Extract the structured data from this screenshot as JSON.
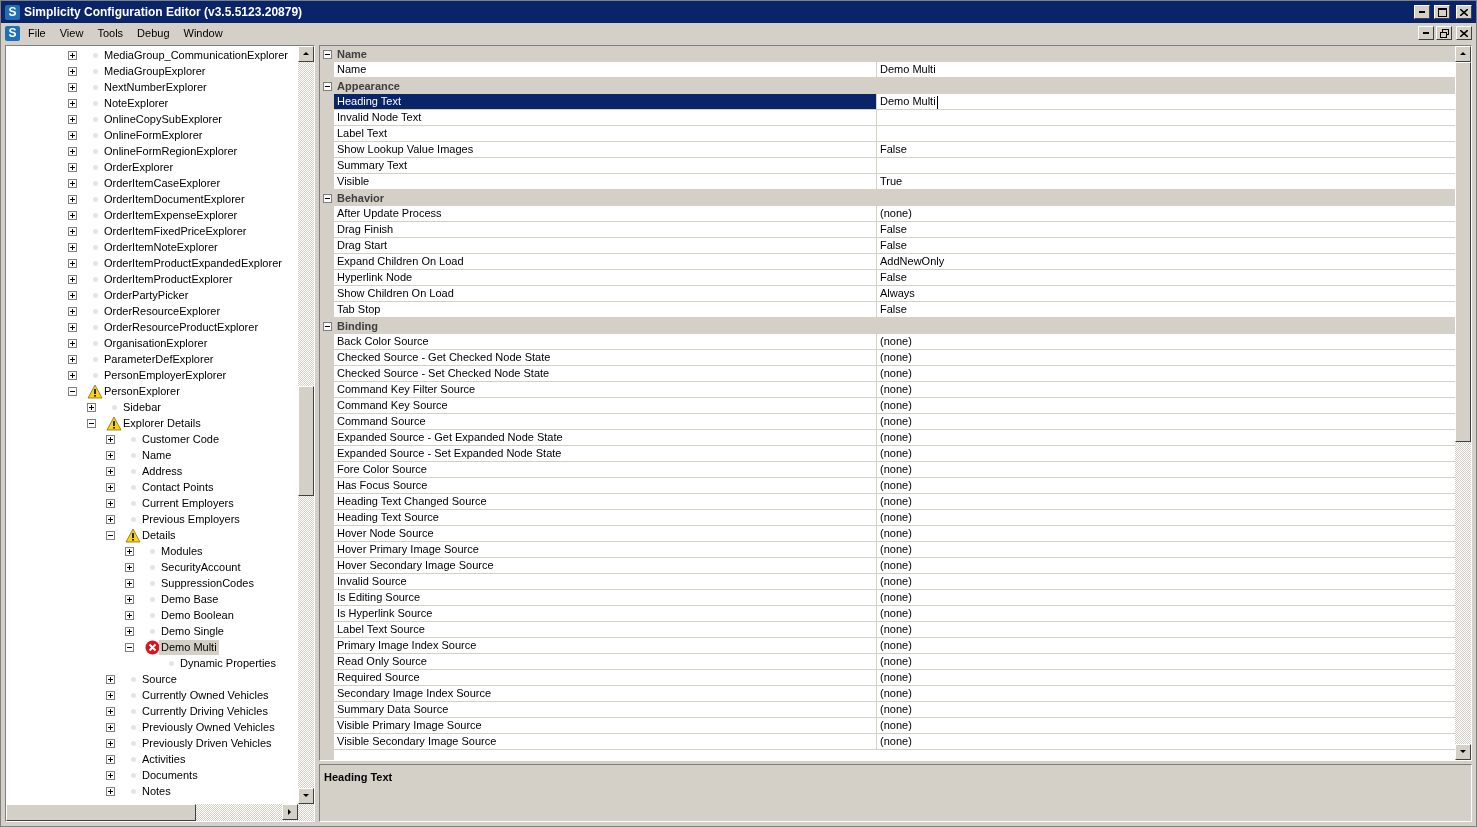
{
  "window": {
    "logo": "S",
    "title": "Simplicity Configuration Editor (v3.5.5123.20879)"
  },
  "menubar": {
    "logo": "S",
    "items": [
      "File",
      "View",
      "Tools",
      "Debug",
      "Window"
    ]
  },
  "tree": [
    {
      "label": "MediaGroup_CommunicationExplorer",
      "kind": "plain",
      "expanded": false,
      "selected": false
    },
    {
      "label": "MediaGroupExplorer",
      "kind": "plain",
      "expanded": false,
      "selected": false
    },
    {
      "label": "NextNumberExplorer",
      "kind": "plain",
      "expanded": false,
      "selected": false
    },
    {
      "label": "NoteExplorer",
      "kind": "plain",
      "expanded": false,
      "selected": false
    },
    {
      "label": "OnlineCopySubExplorer",
      "kind": "plain",
      "expanded": false,
      "selected": false
    },
    {
      "label": "OnlineFormExplorer",
      "kind": "plain",
      "expanded": false,
      "selected": false
    },
    {
      "label": "OnlineFormRegionExplorer",
      "kind": "plain",
      "expanded": false,
      "selected": false
    },
    {
      "label": "OrderExplorer",
      "kind": "plain",
      "expanded": false,
      "selected": false
    },
    {
      "label": "OrderItemCaseExplorer",
      "kind": "plain",
      "expanded": false,
      "selected": false
    },
    {
      "label": "OrderItemDocumentExplorer",
      "kind": "plain",
      "expanded": false,
      "selected": false
    },
    {
      "label": "OrderItemExpenseExplorer",
      "kind": "plain",
      "expanded": false,
      "selected": false
    },
    {
      "label": "OrderItemFixedPriceExplorer",
      "kind": "plain",
      "expanded": false,
      "selected": false
    },
    {
      "label": "OrderItemNoteExplorer",
      "kind": "plain",
      "expanded": false,
      "selected": false
    },
    {
      "label": "OrderItemProductExpandedExplorer",
      "kind": "plain",
      "expanded": false,
      "selected": false
    },
    {
      "label": "OrderItemProductExplorer",
      "kind": "plain",
      "expanded": false,
      "selected": false
    },
    {
      "label": "OrderPartyPicker",
      "kind": "plain",
      "expanded": false,
      "selected": false
    },
    {
      "label": "OrderResourceExplorer",
      "kind": "plain",
      "expanded": false,
      "selected": false
    },
    {
      "label": "OrderResourceProductExplorer",
      "kind": "plain",
      "expanded": false,
      "selected": false
    },
    {
      "label": "OrganisationExplorer",
      "kind": "plain",
      "expanded": false,
      "selected": false
    },
    {
      "label": "ParameterDefExplorer",
      "kind": "plain",
      "expanded": false,
      "selected": false
    },
    {
      "label": "PersonEmployerExplorer",
      "kind": "plain",
      "expanded": false,
      "selected": false
    },
    {
      "label": "PersonExplorer",
      "kind": "warning",
      "expanded": true,
      "selected": false,
      "children": [
        {
          "label": "Sidebar",
          "kind": "plain",
          "expanded": false,
          "selected": false
        },
        {
          "label": "Explorer Details",
          "kind": "warning",
          "expanded": true,
          "selected": false,
          "children": [
            {
              "label": "Customer Code",
              "kind": "plain",
              "expanded": false,
              "selected": false
            },
            {
              "label": "Name",
              "kind": "plain",
              "expanded": false,
              "selected": false
            },
            {
              "label": "Address",
              "kind": "plain",
              "expanded": false,
              "selected": false
            },
            {
              "label": "Contact Points",
              "kind": "plain",
              "expanded": false,
              "selected": false
            },
            {
              "label": "Current Employers",
              "kind": "plain",
              "expanded": false,
              "selected": false
            },
            {
              "label": "Previous Employers",
              "kind": "plain",
              "expanded": false,
              "selected": false
            },
            {
              "label": "Details",
              "kind": "warning",
              "expanded": true,
              "selected": false,
              "children": [
                {
                  "label": "Modules",
                  "kind": "plain",
                  "expanded": false,
                  "selected": false
                },
                {
                  "label": "SecurityAccount",
                  "kind": "plain",
                  "expanded": false,
                  "selected": false
                },
                {
                  "label": "SuppressionCodes",
                  "kind": "plain",
                  "expanded": false,
                  "selected": false
                },
                {
                  "label": "Demo Base",
                  "kind": "plain",
                  "expanded": false,
                  "selected": false
                },
                {
                  "label": "Demo Boolean",
                  "kind": "plain",
                  "expanded": false,
                  "selected": false
                },
                {
                  "label": "Demo Single",
                  "kind": "plain",
                  "expanded": false,
                  "selected": false
                },
                {
                  "label": "Demo Multi",
                  "kind": "error",
                  "expanded": true,
                  "selected": true,
                  "children": [
                    {
                      "label": "Dynamic Properties",
                      "kind": "plain",
                      "selected": false
                    }
                  ]
                }
              ]
            },
            {
              "label": "Source",
              "kind": "plain",
              "expanded": false,
              "selected": false
            },
            {
              "label": "Currently Owned Vehicles",
              "kind": "plain",
              "expanded": false,
              "selected": false
            },
            {
              "label": "Currently Driving Vehicles",
              "kind": "plain",
              "expanded": false,
              "selected": false
            },
            {
              "label": "Previously Owned Vehicles",
              "kind": "plain",
              "expanded": false,
              "selected": false
            },
            {
              "label": "Previously Driven Vehicles",
              "kind": "plain",
              "expanded": false,
              "selected": false
            },
            {
              "label": "Activities",
              "kind": "plain",
              "expanded": false,
              "selected": false
            },
            {
              "label": "Documents",
              "kind": "plain",
              "expanded": false,
              "selected": false
            },
            {
              "label": "Notes",
              "kind": "plain",
              "expanded": false,
              "selected": false
            }
          ]
        }
      ]
    }
  ],
  "properties": [
    {
      "category": "Name",
      "expanded": true,
      "rows": [
        {
          "name": "Name",
          "value": "Demo Multi",
          "selected": false
        }
      ]
    },
    {
      "category": "Appearance",
      "expanded": true,
      "rows": [
        {
          "name": "Heading Text",
          "value": "Demo Multi",
          "selected": true
        },
        {
          "name": "Invalid Node Text",
          "value": "",
          "selected": false
        },
        {
          "name": "Label Text",
          "value": "",
          "selected": false
        },
        {
          "name": "Show Lookup Value Images",
          "value": "False",
          "selected": false
        },
        {
          "name": "Summary Text",
          "value": "",
          "selected": false
        },
        {
          "name": "Visible",
          "value": "True",
          "selected": false
        }
      ]
    },
    {
      "category": "Behavior",
      "expanded": true,
      "rows": [
        {
          "name": "After Update Process",
          "value": "(none)",
          "selected": false
        },
        {
          "name": "Drag Finish",
          "value": "False",
          "selected": false
        },
        {
          "name": "Drag Start",
          "value": "False",
          "selected": false
        },
        {
          "name": "Expand Children On Load",
          "value": "AddNewOnly",
          "selected": false
        },
        {
          "name": "Hyperlink Node",
          "value": "False",
          "selected": false
        },
        {
          "name": "Show Children On Load",
          "value": "Always",
          "selected": false
        },
        {
          "name": "Tab Stop",
          "value": "False",
          "selected": false
        }
      ]
    },
    {
      "category": "Binding",
      "expanded": true,
      "rows": [
        {
          "name": "Back Color Source",
          "value": "(none)",
          "selected": false
        },
        {
          "name": "Checked Source - Get Checked Node State",
          "value": "(none)",
          "selected": false
        },
        {
          "name": "Checked Source - Set Checked Node State",
          "value": "(none)",
          "selected": false
        },
        {
          "name": "Command Key Filter Source",
          "value": "(none)",
          "selected": false
        },
        {
          "name": "Command Key Source",
          "value": "(none)",
          "selected": false
        },
        {
          "name": "Command Source",
          "value": "(none)",
          "selected": false
        },
        {
          "name": "Expanded Source - Get Expanded Node State",
          "value": "(none)",
          "selected": false
        },
        {
          "name": "Expanded Source - Set Expanded Node State",
          "value": "(none)",
          "selected": false
        },
        {
          "name": "Fore Color Source",
          "value": "(none)",
          "selected": false
        },
        {
          "name": "Has Focus Source",
          "value": "(none)",
          "selected": false
        },
        {
          "name": "Heading Text Changed Source",
          "value": "(none)",
          "selected": false
        },
        {
          "name": "Heading Text Source",
          "value": "(none)",
          "selected": false
        },
        {
          "name": "Hover Node Source",
          "value": "(none)",
          "selected": false
        },
        {
          "name": "Hover Primary Image Source",
          "value": "(none)",
          "selected": false
        },
        {
          "name": "Hover Secondary Image Source",
          "value": "(none)",
          "selected": false
        },
        {
          "name": "Invalid Source",
          "value": "(none)",
          "selected": false
        },
        {
          "name": "Is Editing Source",
          "value": "(none)",
          "selected": false
        },
        {
          "name": "Is Hyperlink Source",
          "value": "(none)",
          "selected": false
        },
        {
          "name": "Label Text Source",
          "value": "(none)",
          "selected": false
        },
        {
          "name": "Primary Image Index Source",
          "value": "(none)",
          "selected": false
        },
        {
          "name": "Read Only Source",
          "value": "(none)",
          "selected": false
        },
        {
          "name": "Required Source",
          "value": "(none)",
          "selected": false
        },
        {
          "name": "Secondary Image Index Source",
          "value": "(none)",
          "selected": false
        },
        {
          "name": "Summary Data Source",
          "value": "(none)",
          "selected": false
        },
        {
          "name": "Visible Primary Image Source",
          "value": "(none)",
          "selected": false
        },
        {
          "name": "Visible Secondary Image Source",
          "value": "(none)",
          "selected": false
        }
      ]
    }
  ],
  "description": {
    "title": "Heading Text"
  }
}
